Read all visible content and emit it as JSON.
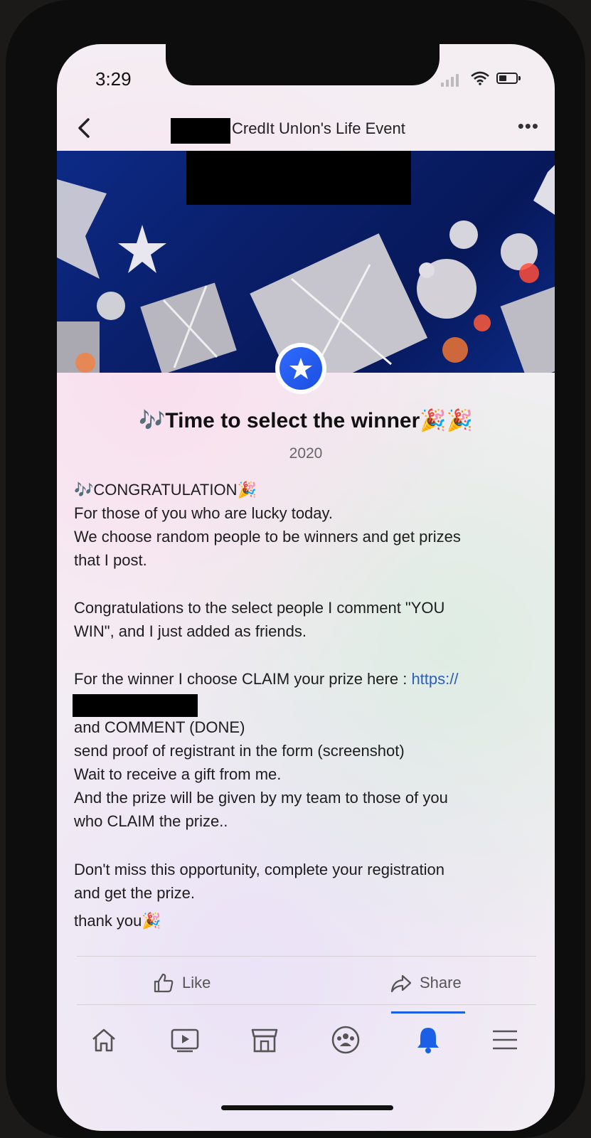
{
  "status_bar": {
    "time": "3:29"
  },
  "header": {
    "title": "CredIt UnIon's Life Event",
    "more": "•••"
  },
  "event": {
    "title": "🎶Time to select the winner🎉🎉",
    "year": "2020"
  },
  "post": {
    "line1": "🎶CONGRATULATION🎉",
    "line2": "For those of you who are lucky today.",
    "line3": "We choose random people to be winners and get prizes",
    "line4": "that I post.",
    "para2_line1": "Congratulations to the select people I comment \"YOU",
    "para2_line2": "WIN\", and I just added as friends.",
    "para3_prefix": "For the winner I choose CLAIM your prize here : ",
    "para3_link": "https://",
    "para4_line1": "and COMMENT (DONE)",
    "para4_line2": "send proof of registrant in the form (screenshot)",
    "para4_line3": "Wait to receive a gift from me.",
    "para4_line4": "And the prize will be given by my team to those of you",
    "para4_line5": "who CLAIM the prize..",
    "para5_line1": "Don't miss this opportunity, complete your registration",
    "para5_line2": "and get the prize.",
    "para5_line3": "thank you🎉"
  },
  "actions": {
    "like": "Like",
    "share": "Share"
  },
  "tabs": [
    {
      "icon": "home-icon"
    },
    {
      "icon": "video-icon"
    },
    {
      "icon": "marketplace-icon"
    },
    {
      "icon": "groups-icon"
    },
    {
      "icon": "notifications-icon",
      "active": true
    },
    {
      "icon": "menu-icon"
    }
  ],
  "colors": {
    "accent": "#1a5fe6",
    "link": "#2d5fb8",
    "cover": "#0c2a86"
  }
}
